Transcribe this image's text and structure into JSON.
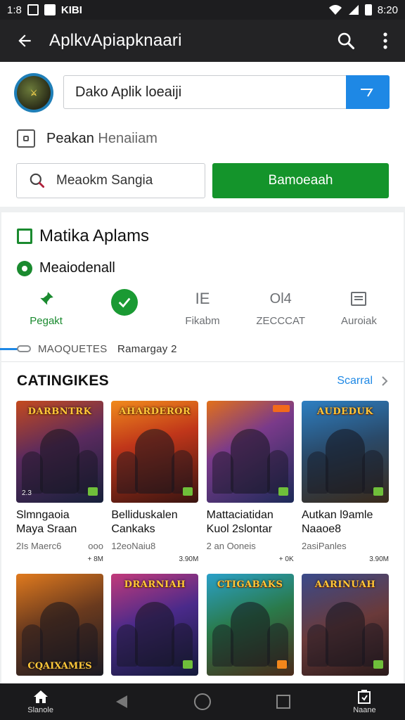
{
  "status_bar": {
    "time": "1:8",
    "carrier": "KIBI",
    "clock": "8:20"
  },
  "app_bar": {
    "title": "AplkvApiapknaari"
  },
  "header": {
    "search_value": "Dako Aplik loeaiji",
    "preference_label": "Peakan",
    "preference_suffix": "Henaiiam",
    "secondary_field_value": "Meaokm Sangia",
    "green_button_label": "Bamoeaah"
  },
  "section": {
    "title": "Matika Aplams",
    "subtitle": "Meaiodenall",
    "tabs": [
      {
        "label": "Pegakt",
        "icon": "pin-icon"
      },
      {
        "label": "",
        "icon": "check-icon"
      },
      {
        "label": "Fikabm",
        "icon": "text-icon",
        "glyph": "IE"
      },
      {
        "label": "ZECCCAT",
        "icon": "text-icon",
        "glyph": "Ol4"
      },
      {
        "label": "Auroiak",
        "icon": "list-icon"
      }
    ],
    "progress_label": "MAOQUETES",
    "progress_value": "Ramargay 2"
  },
  "catalog": {
    "heading": "CATINGIKES",
    "more_label": "Scarral",
    "games": [
      {
        "title_1": "Slmngaoia",
        "title_2": "Maya Sraan",
        "sub": "2Is Maerc6",
        "extra": "ooo",
        "price": "+ 8M",
        "logo": "DARBNTRK",
        "corner": "2.3",
        "bg": "linear-gradient(160deg,#c44a1e 0%,#5a2a5e 45%,#16203a 100%)"
      },
      {
        "title_1": "Belliduskalen",
        "title_2": "Cankaks",
        "sub": "12eoNaiu8",
        "extra": "",
        "price": "3.90M",
        "logo": "AHARDEROR",
        "corner": "",
        "bg": "linear-gradient(165deg,#f08a1c 0%,#c0361a 40%,#3a1410 100%)"
      },
      {
        "title_1": "Mattaciatidan",
        "title_2": "Kuol 2slontar",
        "sub": "2 an Ooneis",
        "extra": "",
        "price": "+ 0K",
        "logo": "",
        "corner": "",
        "bg": "linear-gradient(150deg,#e2701a 0%,#7a3a8a 40%,#1c2a58 100%)"
      },
      {
        "title_1": "Autkan l9amle",
        "title_2": "Naaoe8",
        "sub": "2asiPanles",
        "extra": "",
        "price": "3.90M",
        "logo": "AUDEDUK",
        "corner": "",
        "bg": "linear-gradient(165deg,#2d7fc2 0%,#2a4a6a 45%,#3a2a1a 100%)"
      },
      {
        "title_1": "",
        "title_2": "",
        "sub": "",
        "extra": "",
        "price": "",
        "logo": "",
        "bottom_logo": "CQAIXAMES",
        "corner": "",
        "bg": "linear-gradient(160deg,#e07a1e 0%,#6a3a1e 45%,#1a1a22 100%)"
      },
      {
        "title_1": "",
        "title_2": "",
        "sub": "",
        "extra": "",
        "price": "",
        "logo": "DRARNIAH",
        "corner": "",
        "bg": "linear-gradient(160deg,#c23a7a 0%,#4a2a8a 45%,#141a3a 100%)"
      },
      {
        "title_1": "",
        "title_2": "",
        "sub": "",
        "extra": "",
        "price": "",
        "logo": "CTIGABAKS",
        "corner": "",
        "bg": "linear-gradient(160deg,#2aa0c8 0%,#2a7a4a 45%,#4a2a1a 100%)"
      },
      {
        "title_1": "",
        "title_2": "",
        "sub": "",
        "extra": "",
        "price": "",
        "logo": "AARINUAH",
        "corner": "",
        "bg": "linear-gradient(160deg,#3a4a8a 0%,#6a3a3a 50%,#2a1a1a 100%)"
      }
    ]
  },
  "nav": {
    "home_label": "Slanole",
    "recent_label": "Naane"
  },
  "colors": {
    "accent_blue": "#1e88e5",
    "accent_green": "#14942b",
    "app_bar": "#232325"
  }
}
